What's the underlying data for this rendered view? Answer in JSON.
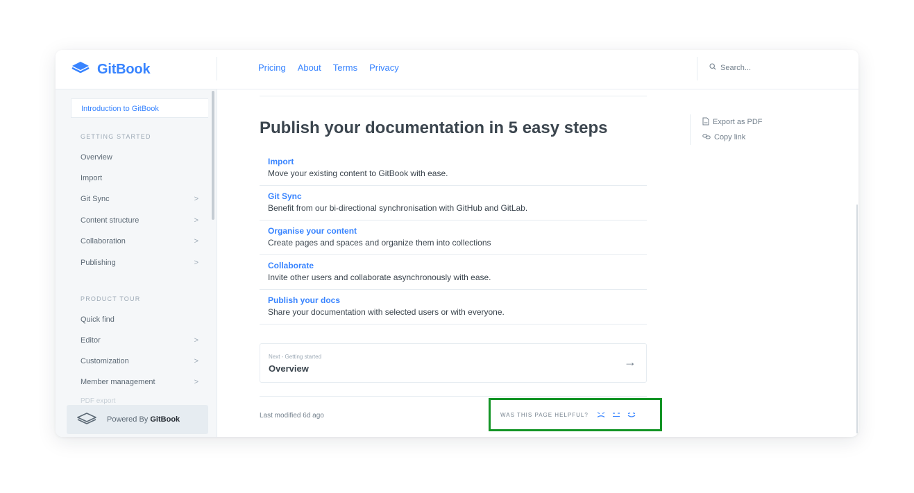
{
  "header": {
    "logo_text": "GitBook",
    "nav": [
      "Pricing",
      "About",
      "Terms",
      "Privacy"
    ],
    "search_placeholder": "Search..."
  },
  "sidebar": {
    "active_item": "Introduction to GitBook",
    "sections": [
      {
        "heading": "GETTING STARTED",
        "items": [
          {
            "label": "Overview",
            "expandable": false
          },
          {
            "label": "Import",
            "expandable": false
          },
          {
            "label": "Git Sync",
            "expandable": true
          },
          {
            "label": "Content structure",
            "expandable": true
          },
          {
            "label": "Collaboration",
            "expandable": true
          },
          {
            "label": "Publishing",
            "expandable": true
          }
        ]
      },
      {
        "heading": "PRODUCT TOUR",
        "items": [
          {
            "label": "Quick find",
            "expandable": false
          },
          {
            "label": "Editor",
            "expandable": true
          },
          {
            "label": "Customization",
            "expandable": true
          },
          {
            "label": "Member management",
            "expandable": true
          }
        ]
      }
    ],
    "faded_item": "PDF export",
    "powered_prefix": "Powered By",
    "powered_brand": "GitBook",
    "chevron": ">"
  },
  "main": {
    "heading": "Publish your documentation in 5 easy steps",
    "steps": [
      {
        "title": "Import",
        "desc": "Move your existing content to GitBook with ease."
      },
      {
        "title": "Git Sync",
        "desc": "Benefit from our bi-directional synchronisation with GitHub and GitLab."
      },
      {
        "title": "Organise your content",
        "desc": "Create pages and spaces and organize them into collections"
      },
      {
        "title": "Collaborate",
        "desc": "Invite other users and collaborate asynchronously with ease."
      },
      {
        "title": "Publish your docs",
        "desc": "Share your documentation with selected users or with everyone."
      }
    ],
    "next": {
      "small": "Next - Getting started",
      "title": "Overview",
      "arrow": "→"
    },
    "last_modified": "Last modified 6d ago",
    "helpful_question": "WAS THIS PAGE HELPFUL?"
  },
  "aside": {
    "export_pdf": "Export as PDF",
    "copy_link": "Copy link"
  },
  "colors": {
    "accent": "#3884ff",
    "highlight_border": "#139425",
    "sidebar_bg": "#f5f7f9"
  }
}
